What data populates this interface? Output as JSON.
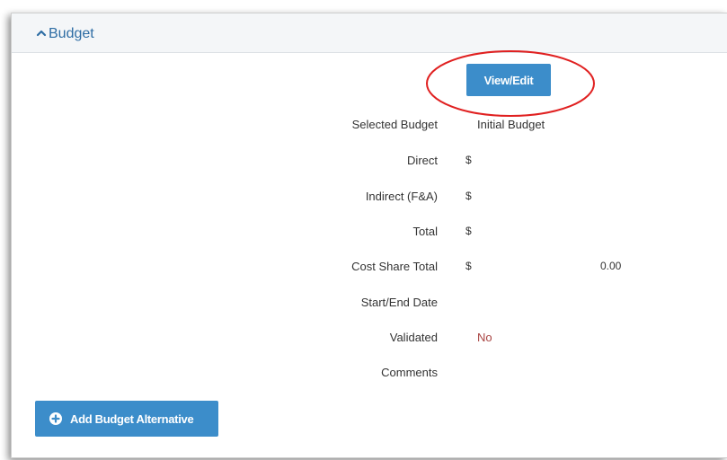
{
  "panel": {
    "title": "Budget",
    "toggle_icon": "chevron-up-icon"
  },
  "view_edit_button": {
    "label": "View/Edit"
  },
  "details": {
    "selected_budget": {
      "label": "Selected Budget",
      "value": "Initial Budget"
    },
    "direct": {
      "label": "Direct",
      "currency": "$"
    },
    "indirect": {
      "label": "Indirect (F&A)",
      "currency": "$"
    },
    "total": {
      "label": "Total",
      "currency": "$"
    },
    "cost_share_total": {
      "label": "Cost Share Total",
      "currency": "$",
      "amount": "0.00"
    },
    "start_end_date": {
      "label": "Start/End Date"
    },
    "validated": {
      "label": "Validated",
      "value": "No"
    },
    "comments": {
      "label": "Comments"
    }
  },
  "add_alternative_button": {
    "label": "Add Budget Alternative",
    "icon": "plus-circle-icon"
  },
  "colors": {
    "accent": "#3c8dca",
    "title": "#2e6da4",
    "negative": "#a94442",
    "highlight": "#e02020"
  }
}
